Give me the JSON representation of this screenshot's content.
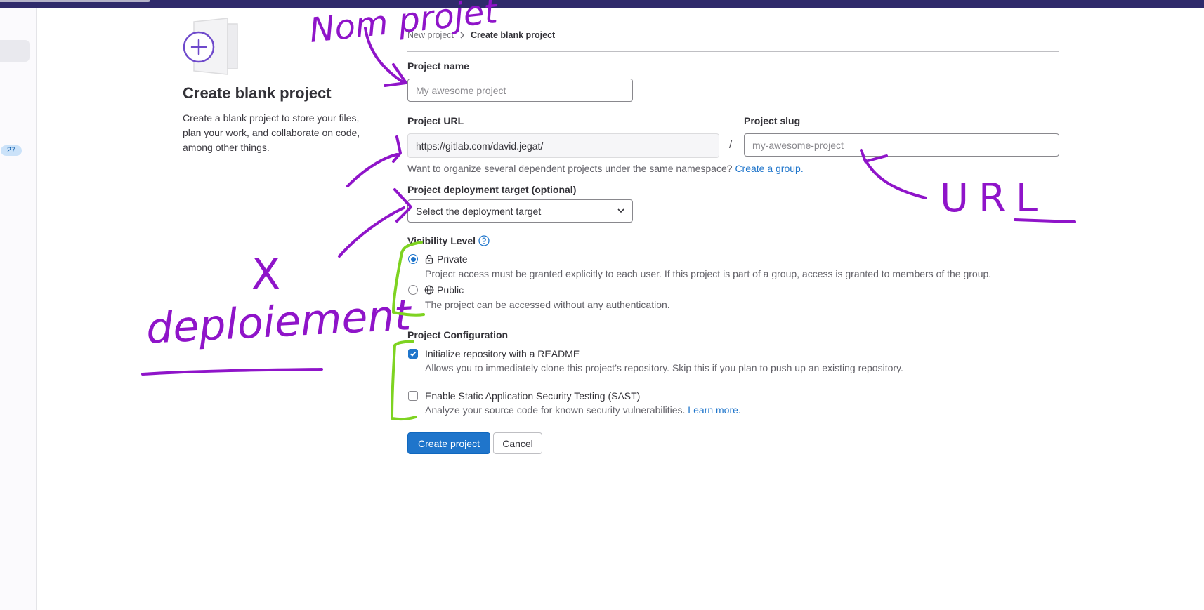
{
  "sidebar": {
    "badge_count": "27"
  },
  "left_panel": {
    "title": "Create blank project",
    "description": "Create a blank project to store your files, plan your work, and collaborate on code, among other things."
  },
  "breadcrumb": {
    "parent": "New project",
    "current": "Create blank project"
  },
  "form": {
    "project_name": {
      "label": "Project name",
      "placeholder": "My awesome project"
    },
    "project_url": {
      "label": "Project URL",
      "value": "https://gitlab.com/david.jegat/"
    },
    "separator": "/",
    "project_slug": {
      "label": "Project slug",
      "placeholder": "my-awesome-project"
    },
    "namespace_hint": "Want to organize several dependent projects under the same namespace?",
    "namespace_link": "Create a group.",
    "deployment": {
      "label": "Project deployment target (optional)",
      "selected": "Select the deployment target"
    },
    "visibility": {
      "label": "Visibility Level",
      "options": [
        {
          "label": "Private",
          "description": "Project access must be granted explicitly to each user. If this project is part of a group, access is granted to members of the group.",
          "checked": true,
          "icon": "lock-icon"
        },
        {
          "label": "Public",
          "description": "The project can be accessed without any authentication.",
          "checked": false,
          "icon": "globe-icon"
        }
      ]
    },
    "configuration": {
      "label": "Project Configuration",
      "options": [
        {
          "label": "Initialize repository with a README",
          "description": "Allows you to immediately clone this project’s repository. Skip this if you plan to push up an existing repository.",
          "checked": true
        },
        {
          "label": "Enable Static Application Security Testing (SAST)",
          "description": "Analyze your source code for known security vulnerabilities.",
          "link": "Learn more.",
          "checked": false
        }
      ]
    },
    "buttons": {
      "create": "Create project",
      "cancel": "Cancel"
    }
  },
  "handwritten_annotations": {
    "name_note": "Nom projet",
    "url_note": "URL",
    "deployment_note": "deploiement",
    "cross_mark": "X"
  },
  "colors": {
    "accent": "#1f75cb",
    "annotation_purple": "#8f14c9",
    "annotation_green": "#7ed321",
    "topbar": "#2f2a6b"
  }
}
